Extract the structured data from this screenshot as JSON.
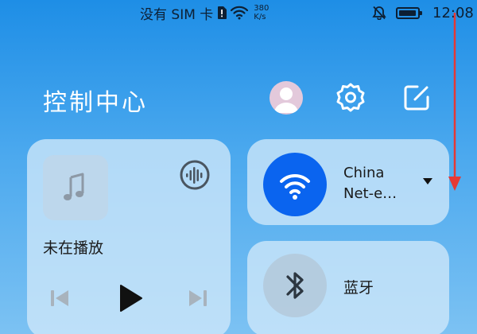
{
  "status_bar": {
    "sim_text": "没有 SIM 卡",
    "net_speed_value": "380",
    "net_speed_unit": "K/s",
    "time": "12:08",
    "icons": [
      "sim-alert-icon",
      "wifi-icon",
      "mute-bell-icon",
      "battery-icon"
    ]
  },
  "header": {
    "title": "控制中心",
    "icons": [
      "avatar",
      "gear-icon",
      "edit-icon"
    ]
  },
  "media": {
    "status": "未在播放",
    "icons": [
      "music-note-icon",
      "audio-output-icon",
      "previous-icon",
      "play-icon",
      "next-icon"
    ]
  },
  "wifi": {
    "name": "China Net-e…",
    "icons": [
      "wifi-icon",
      "caret-down-icon"
    ],
    "accent": "#0A64EF"
  },
  "bluetooth": {
    "label": "蓝牙",
    "icons": [
      "bluetooth-icon"
    ]
  },
  "annotation": {
    "arrow_color": "#E53935"
  }
}
